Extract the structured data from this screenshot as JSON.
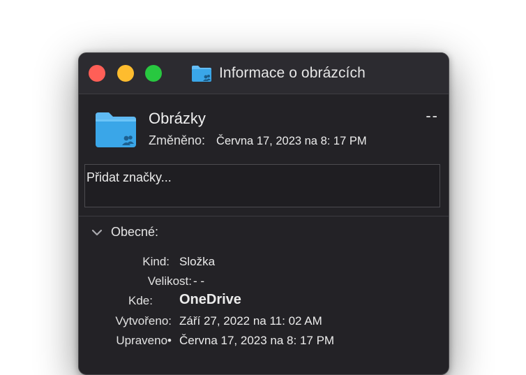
{
  "window": {
    "title": "Informace o obrázcích"
  },
  "header": {
    "name": "Obrázky",
    "size": "--",
    "modified_label": "Změněno:",
    "modified_value": "Června 17, 2023 na 8: 17 PM"
  },
  "tags": {
    "placeholder": "Přidat značky..."
  },
  "general": {
    "title": "Obecné:",
    "rows": [
      {
        "label": "Kind:",
        "value": "Složka"
      },
      {
        "label": "Velikost:",
        "value": "- -"
      },
      {
        "label": "Kde:",
        "value": "OneDrive"
      },
      {
        "label": "Vytvořeno:",
        "value": "Září 27, 2022 na 11: 02 AM"
      },
      {
        "label": "Upraveno•",
        "value": "Června 17, 2023 na 8: 17 PM"
      }
    ]
  },
  "colors": {
    "close": "#ff5f57",
    "minimize": "#febc2e",
    "maximize": "#28c840",
    "folder": "#3aa6e8"
  },
  "icons": {
    "title": "shared-folder-icon",
    "header": "shared-folder-icon",
    "disclosure": "chevron-down-icon"
  }
}
